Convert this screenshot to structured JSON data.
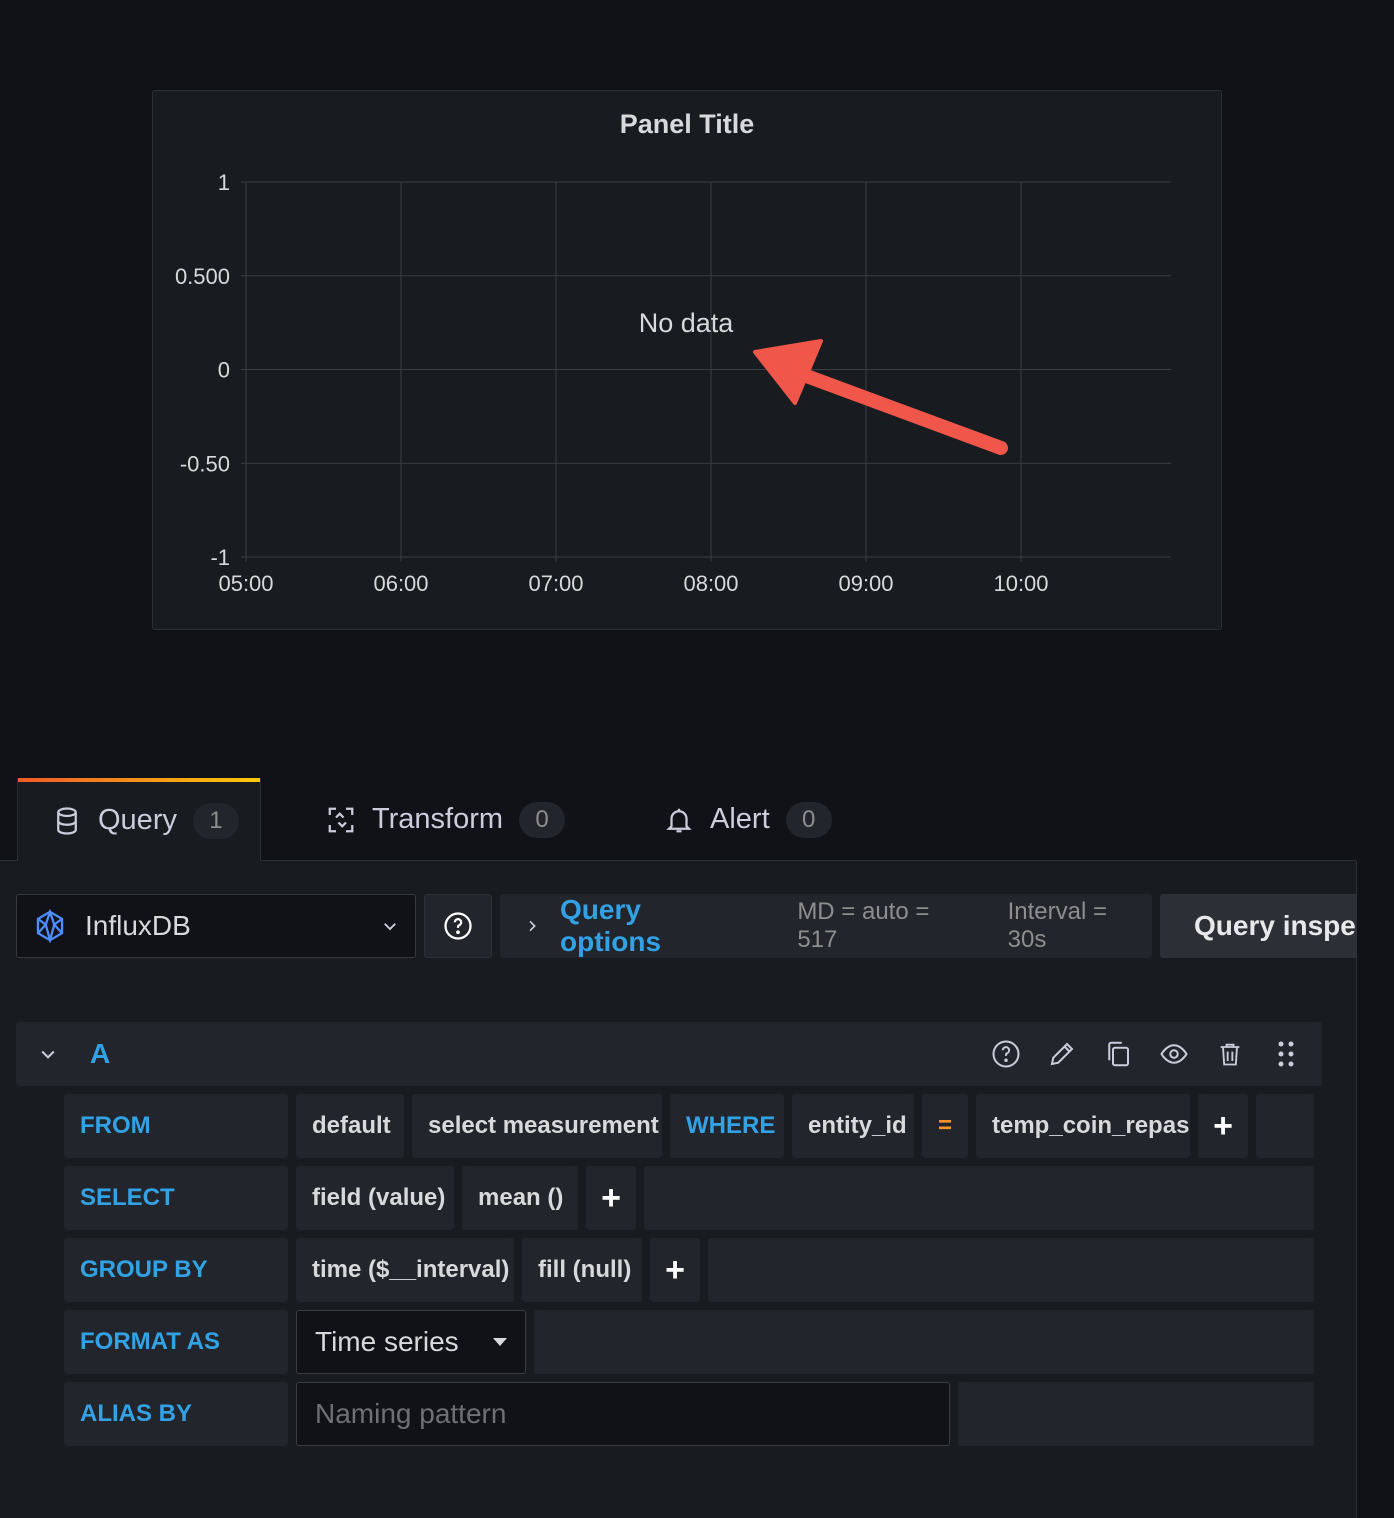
{
  "panel": {
    "title": "Panel Title",
    "no_data": "No data"
  },
  "chart_data": {
    "type": "line",
    "y_ticks": [
      "1",
      "0.500",
      "0",
      "-0.50",
      "-1"
    ],
    "x_ticks": [
      "05:00",
      "06:00",
      "07:00",
      "08:00",
      "09:00",
      "10:00"
    ],
    "ylim": [
      -1,
      1
    ],
    "grid": true,
    "series": []
  },
  "tabs": [
    {
      "label": "Query",
      "count": "1",
      "icon": "database-icon"
    },
    {
      "label": "Transform",
      "count": "0",
      "icon": "transform-icon"
    },
    {
      "label": "Alert",
      "count": "0",
      "icon": "bell-icon"
    }
  ],
  "toolbar": {
    "datasource": "InfluxDB",
    "query_options_label": "Query options",
    "md": "MD = auto = 517",
    "interval": "Interval = 30s",
    "query_inspector": "Query inspector"
  },
  "query": {
    "ref_id": "A",
    "from_label": "FROM",
    "from_policy": "default",
    "from_measurement": "select measurement",
    "where_label": "WHERE",
    "where_key": "entity_id",
    "where_op": "=",
    "where_value": "temp_coin_repas",
    "select_label": "SELECT",
    "select_field": "field (value)",
    "select_fn": "mean ()",
    "group_label": "GROUP BY",
    "group_time": "time ($__interval)",
    "group_fill": "fill (null)",
    "format_label": "FORMAT AS",
    "format_value": "Time series",
    "alias_label": "ALIAS BY",
    "alias_placeholder": "Naming pattern",
    "plus": "+"
  },
  "colors": {
    "accent_blue": "#33a2e5",
    "operator_orange": "#f79520",
    "annotation_arrow": "#f0564a",
    "tab_gradient_start": "#f05a28",
    "tab_gradient_end": "#fbca0a"
  }
}
